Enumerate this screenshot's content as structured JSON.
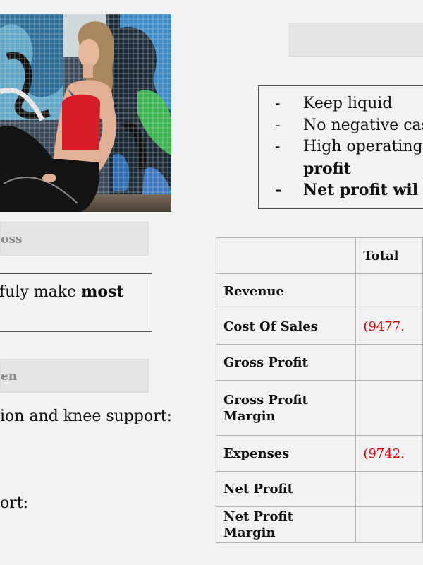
{
  "colors": {
    "negative": "#e00000",
    "bar_background": "#e5e5e5",
    "page_background": "#f2f2f2"
  },
  "photo": {
    "icon": "photo-woman-graffiti-wall"
  },
  "left": {
    "bar1_text": "oss",
    "box1_text_normal": "fuly make ",
    "box1_text_bold": "most",
    "bar2_text": "en",
    "line1": "ion and knee support:",
    "line2": "ort:"
  },
  "right": {
    "bullet_dash": "-",
    "bullets": [
      "Keep liquid",
      "No negative cas",
      "High operating",
      "profit",
      "Net profit wil"
    ]
  },
  "table": {
    "header": [
      "",
      "Total"
    ],
    "rows": [
      {
        "label": "Revenue",
        "value": ""
      },
      {
        "label": "Cost Of Sales",
        "value": "(9477."
      },
      {
        "label": "Gross Profit",
        "value": ""
      },
      {
        "label": "Gross Profit Margin",
        "value": ""
      },
      {
        "label": "Expenses",
        "value": "(9742."
      },
      {
        "label": "Net Profit",
        "value": ""
      },
      {
        "label": "Net Profit Margin",
        "value": ""
      }
    ]
  }
}
